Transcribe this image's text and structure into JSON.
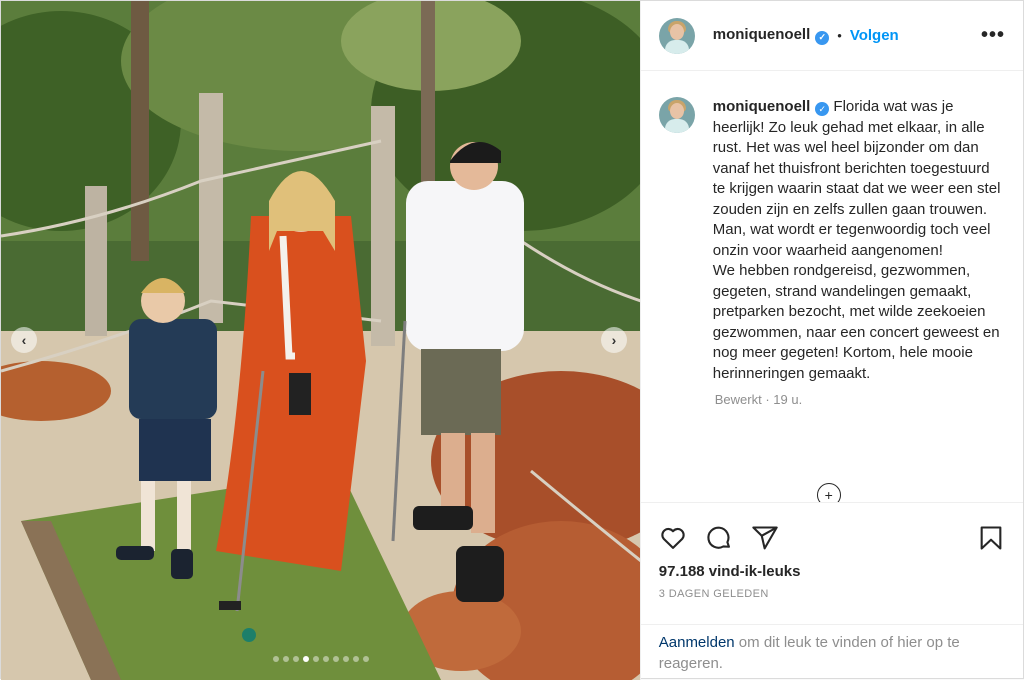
{
  "header": {
    "username": "moniquenoell",
    "separator": "•",
    "follow_label": "Volgen",
    "more_icon": "more-horizontal-icon"
  },
  "caption": {
    "username": "moniquenoell",
    "text": "Florida wat was je heerlijk! Zo leuk gehad met elkaar, in alle rust. Het was wel heel bijzonder om dan vanaf het thuisfront berichten toegestuurd te krijgen waarin staat dat we weer een stel zouden zijn en zelfs zullen gaan trouwen. Man, wat wordt er tegenwoordig toch veel onzin voor waarheid aangenomen!\nWe hebben rondgereisd, gezwommen, gegeten, strand wandelingen gemaakt, pretparken bezocht, met wilde zeekoeien gezwommen, naar een concert geweest en nog meer gegeten! Kortom, hele mooie herinneringen gemaakt.",
    "meta": "Bewerkt · 19 u."
  },
  "actions": {
    "icons": [
      "heart-icon",
      "comment-icon",
      "share-icon",
      "bookmark-icon"
    ],
    "likes": "97.188 vind-ik-leuks",
    "date": "3 DAGEN GELEDEN"
  },
  "login": {
    "link": "Aanmelden",
    "text": " om dit leuk te vinden of hier op te reageren."
  },
  "carousel": {
    "count": 10,
    "active_index": 3
  },
  "colors": {
    "accent": "#0095f6",
    "verified": "#3897f0",
    "muted": "#8e8e8e"
  }
}
